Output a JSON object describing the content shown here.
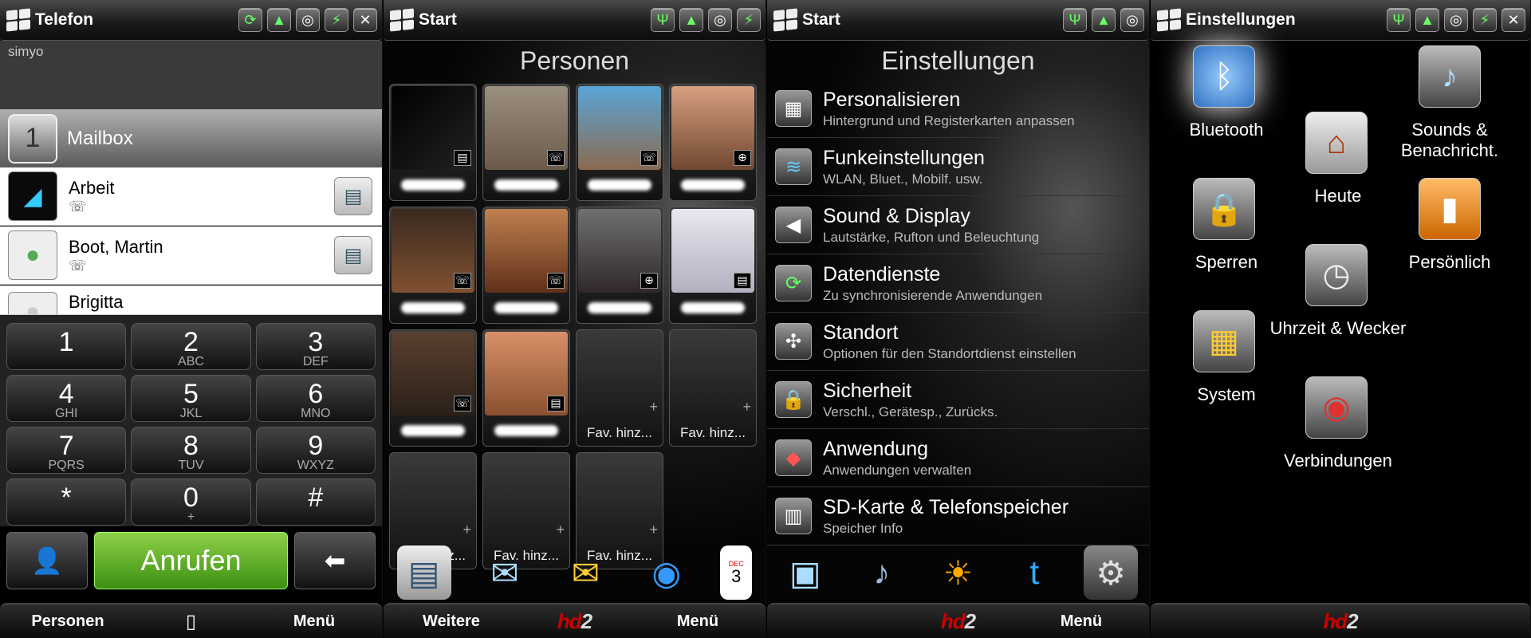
{
  "phone": {
    "title": "Telefon",
    "carrier": "simyo",
    "mailbox": {
      "number": "1",
      "label": "Mailbox"
    },
    "contacts": [
      {
        "name": "Arbeit"
      },
      {
        "name": "Boot, Martin"
      },
      {
        "name": "Brigitta"
      }
    ],
    "keys": [
      {
        "digit": "1",
        "letters": ""
      },
      {
        "digit": "2",
        "letters": "ABC"
      },
      {
        "digit": "3",
        "letters": "DEF"
      },
      {
        "digit": "4",
        "letters": "GHI"
      },
      {
        "digit": "5",
        "letters": "JKL"
      },
      {
        "digit": "6",
        "letters": "MNO"
      },
      {
        "digit": "7",
        "letters": "PQRS"
      },
      {
        "digit": "8",
        "letters": "TUV"
      },
      {
        "digit": "9",
        "letters": "WXYZ"
      },
      {
        "digit": "*",
        "letters": ""
      },
      {
        "digit": "0",
        "letters": "+"
      },
      {
        "digit": "#",
        "letters": ""
      }
    ],
    "call_label": "Anrufen",
    "softkey_left": "Personen",
    "softkey_right": "Menü"
  },
  "people": {
    "title": "Start",
    "header": "Personen",
    "add_fav": "Fav. hinz...",
    "softkey_left": "Weitere",
    "softkey_right": "Menü",
    "dock_date": "3",
    "dock_month": "DEC"
  },
  "settings": {
    "title": "Start",
    "header": "Einstellungen",
    "items": [
      {
        "title": "Personalisieren",
        "sub": "Hintergrund und Registerkarten anpassen"
      },
      {
        "title": "Funkeinstellungen",
        "sub": "WLAN, Bluet., Mobilf. usw."
      },
      {
        "title": "Sound & Display",
        "sub": "Lautstärke, Rufton und Beleuchtung"
      },
      {
        "title": "Datendienste",
        "sub": "Zu synchronisierende Anwendungen"
      },
      {
        "title": "Standort",
        "sub": "Optionen für den Standortdienst einstellen"
      },
      {
        "title": "Sicherheit",
        "sub": "Verschl., Gerätesp., Zurücks."
      },
      {
        "title": "Anwendung",
        "sub": "Anwendungen verwalten"
      },
      {
        "title": "SD-Karte & Telefonspeicher",
        "sub": "Speicher Info"
      }
    ],
    "softkey_right": "Menü"
  },
  "einstellungen": {
    "title": "Einstellungen",
    "items": [
      {
        "label": "Bluetooth"
      },
      {
        "label": "Sounds & Benachricht."
      },
      {
        "label": "Heute"
      },
      {
        "label": "Sperren"
      },
      {
        "label": "Persönlich"
      },
      {
        "label": "Uhrzeit & Wecker"
      },
      {
        "label": "System"
      },
      {
        "label": "Verbindungen"
      }
    ]
  },
  "brand": {
    "hd": "hd",
    "two": "2"
  }
}
